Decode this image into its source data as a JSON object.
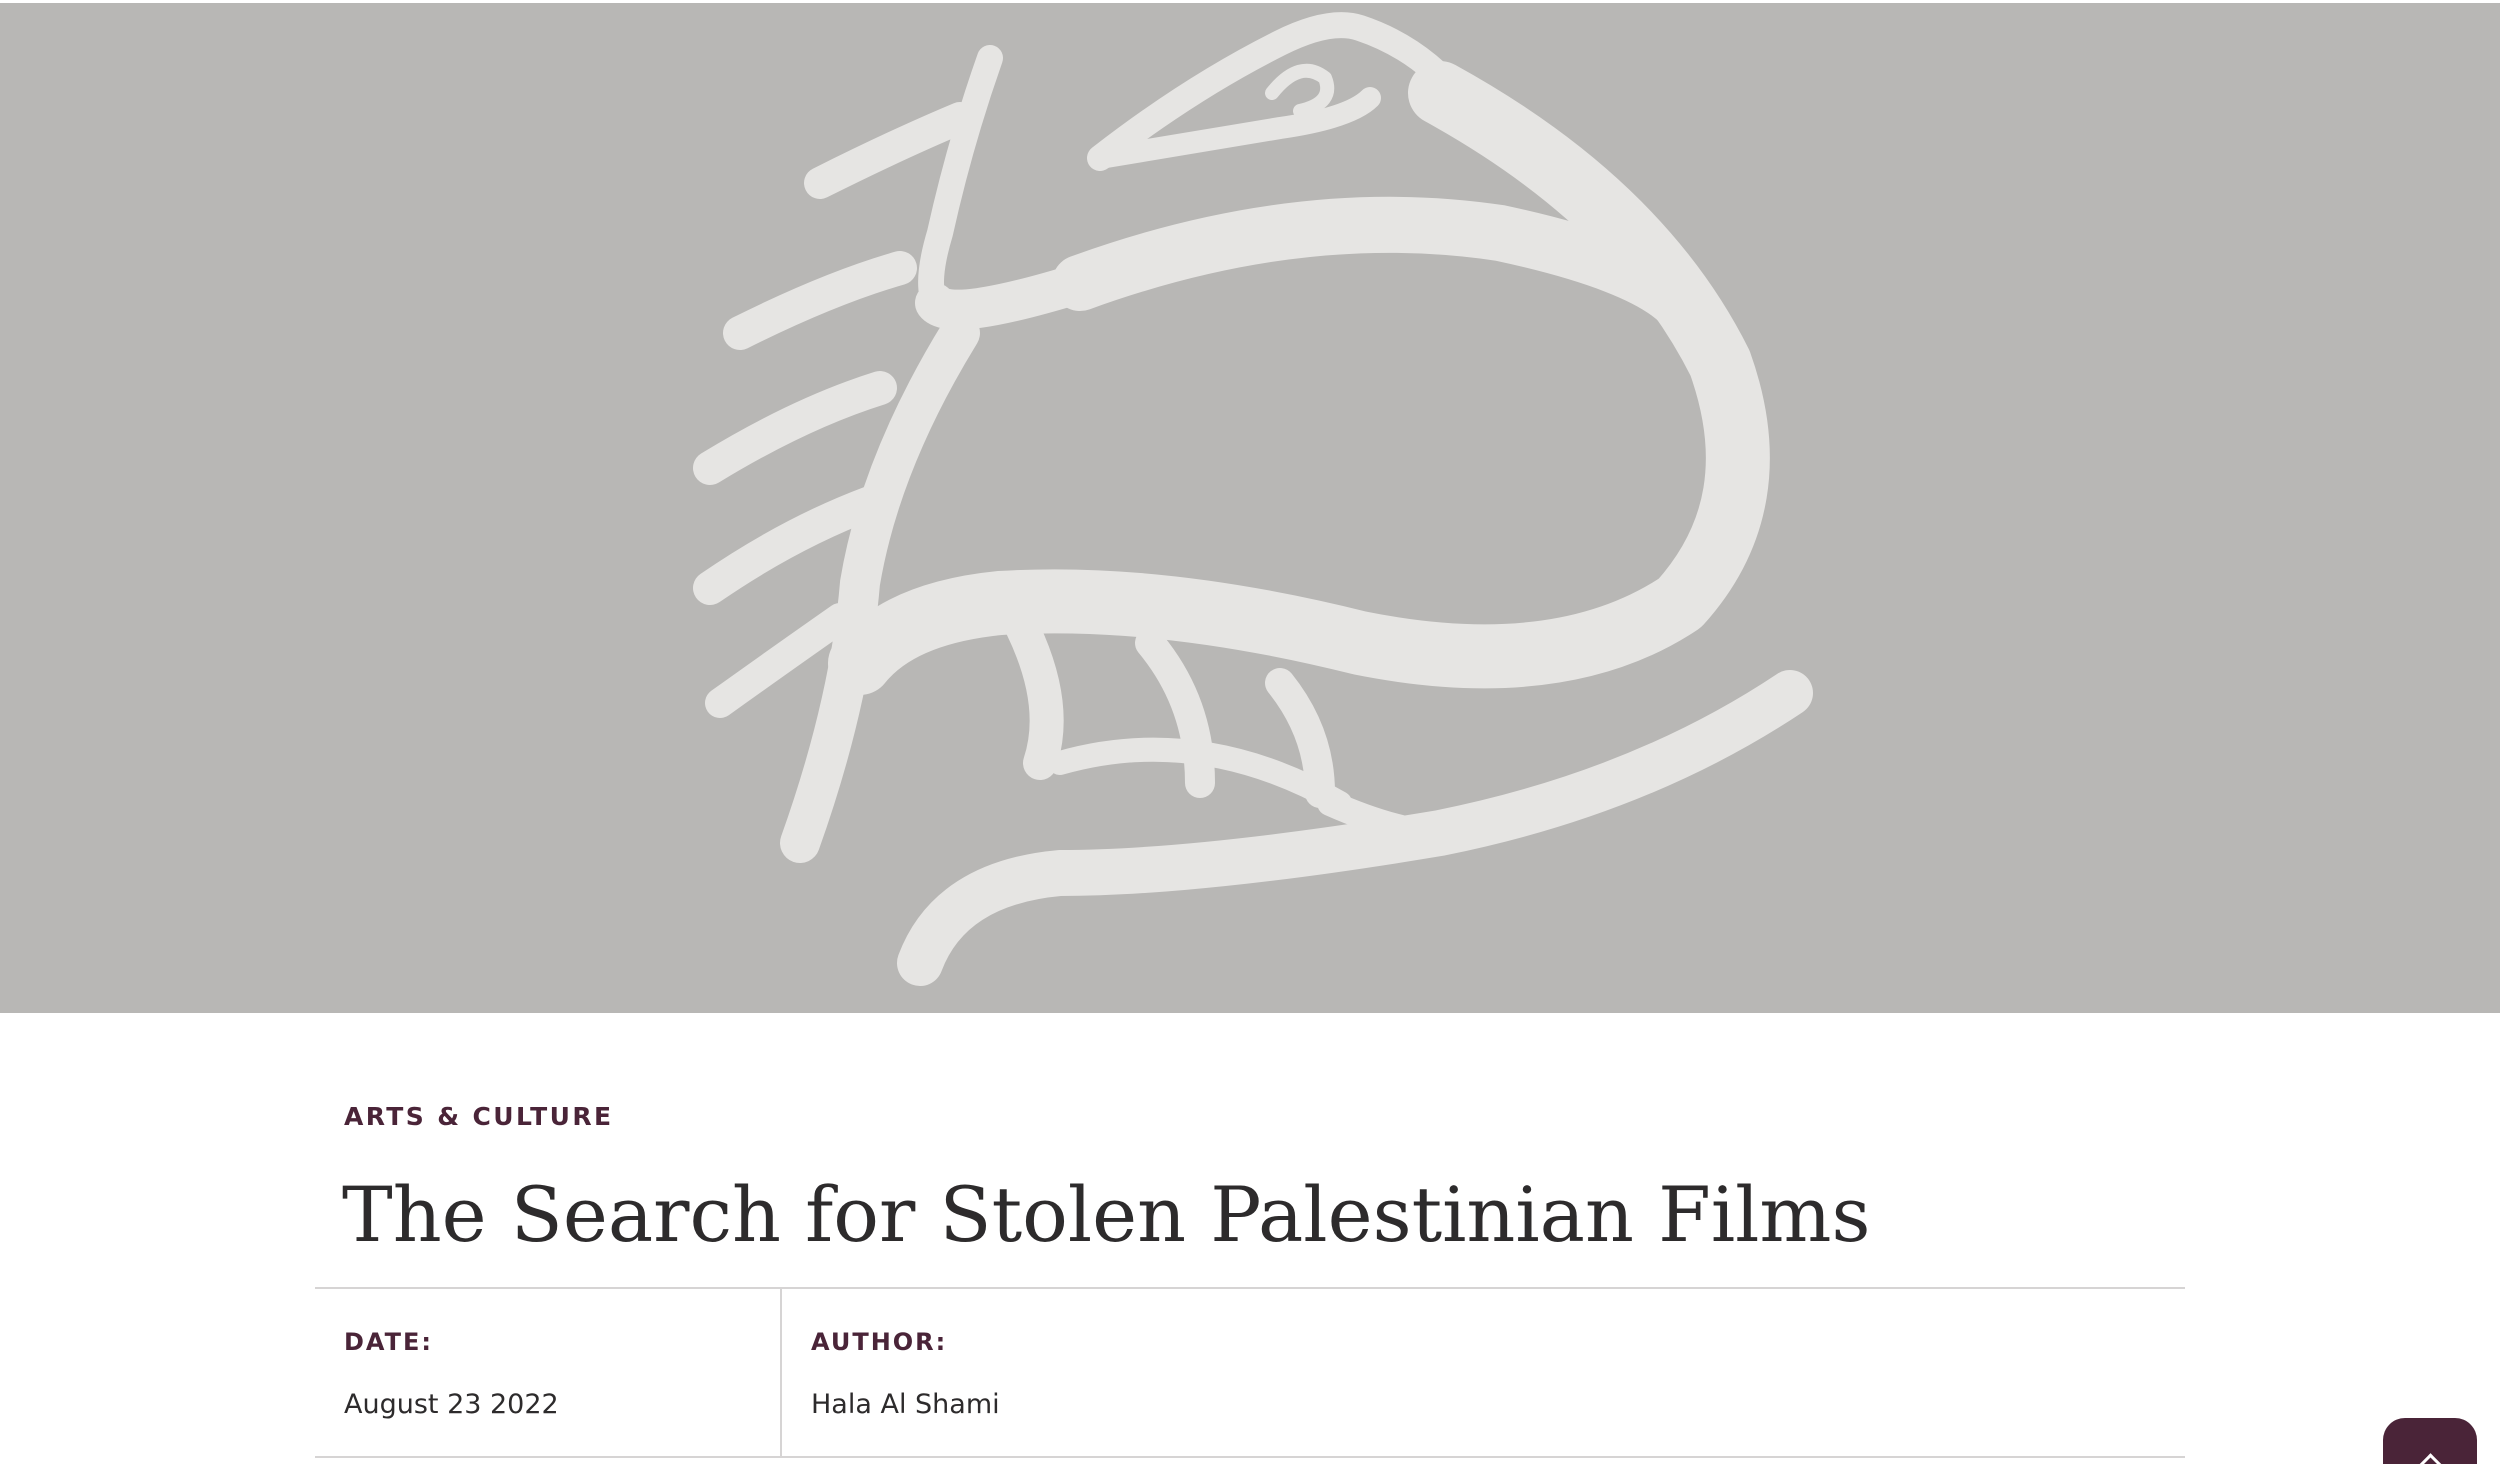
{
  "hero": {
    "image": "bird-emblem-icon",
    "background_color": "#b8b7b5",
    "emblem_color": "#e6e5e3"
  },
  "article": {
    "category": "ARTS & CULTURE",
    "title": "The Search for Stolen Palestinian Films",
    "meta": {
      "date_label": "DATE:",
      "date_value": "August 23 2022",
      "author_label": "AUTHOR:",
      "author_value": "Hala Al Shami"
    }
  },
  "controls": {
    "scroll_top_icon": "chevron-up-icon"
  },
  "colors": {
    "accent": "#4a2438",
    "text": "#2d2b2c",
    "rule": "#d6d4d4"
  }
}
